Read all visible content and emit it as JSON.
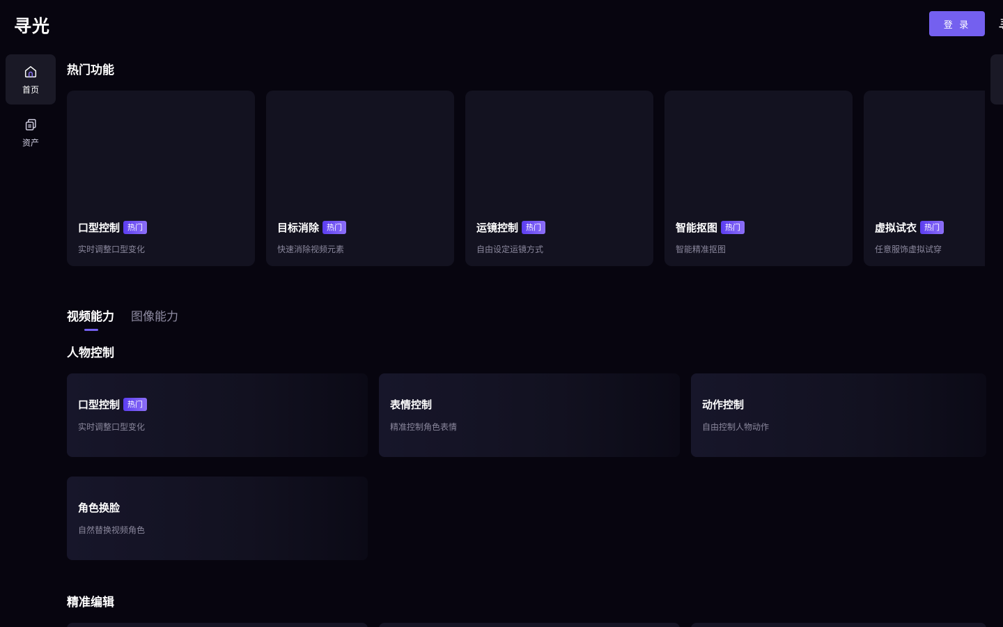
{
  "header": {
    "logo": "寻光",
    "login_label": "登 录",
    "edge_glyph": "寻"
  },
  "sidebar": {
    "items": [
      {
        "label": "首页",
        "icon": "home-icon"
      },
      {
        "label": "资产",
        "icon": "assets-icon"
      }
    ]
  },
  "hot_section": {
    "title": "热门功能",
    "badge": "热门",
    "cards": [
      {
        "title": "口型控制",
        "desc": "实时调整口型变化"
      },
      {
        "title": "目标消除",
        "desc": "快速消除视频元素"
      },
      {
        "title": "运镜控制",
        "desc": "自由设定运镜方式"
      },
      {
        "title": "智能抠图",
        "desc": "智能精准抠图"
      },
      {
        "title": "虚拟试衣",
        "desc": "任意服饰虚拟试穿"
      }
    ]
  },
  "tabs": [
    {
      "label": "视频能力",
      "active": true
    },
    {
      "label": "图像能力",
      "active": false
    }
  ],
  "character_section": {
    "title": "人物控制",
    "badge": "热门",
    "cards": [
      {
        "title": "口型控制",
        "desc": "实时调整口型变化",
        "hot": true
      },
      {
        "title": "表情控制",
        "desc": "精准控制角色表情",
        "hot": false
      },
      {
        "title": "动作控制",
        "desc": "自由控制人物动作",
        "hot": false
      },
      {
        "title": "角色换脸",
        "desc": "自然替换视频角色",
        "hot": false
      }
    ]
  },
  "edit_section": {
    "title": "精准编辑"
  },
  "colors": {
    "accent": "#7460ef",
    "background": "#07050f",
    "card": "#131220"
  }
}
